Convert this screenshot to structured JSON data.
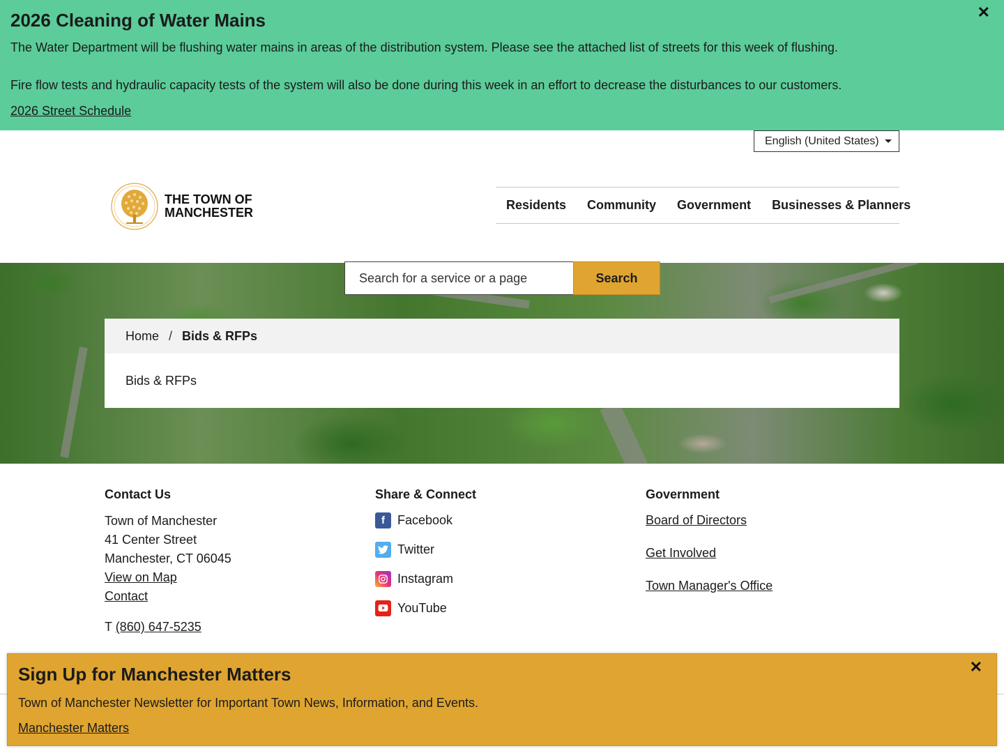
{
  "alert": {
    "title": "2026 Cleaning of Water Mains",
    "paragraph1": "The Water Department will be flushing water mains in areas of the distribution system. Please see the attached list of streets for this week of flushing.",
    "paragraph2": "Fire flow tests and hydraulic capacity tests of the system will also be done during this week in an effort to decrease the disturbances to our customers.",
    "link": "2026 Street Schedule",
    "close": "✕",
    "bg_color": "#5bcc9a"
  },
  "language": {
    "selected": "English (United States)"
  },
  "logo": {
    "line1": "THE TOWN OF",
    "line2": "MANCHESTER"
  },
  "nav": {
    "items": [
      "Residents",
      "Community",
      "Government",
      "Businesses & Planners"
    ]
  },
  "search": {
    "placeholder": "Search for a service or a page",
    "button": "Search",
    "accent": "#e0a530"
  },
  "breadcrumb": {
    "home": "Home",
    "separator": "/",
    "current": "Bids & RFPs"
  },
  "page": {
    "body": "Bids & RFPs"
  },
  "footer": {
    "contact": {
      "heading": "Contact Us",
      "name": "Town of Manchester",
      "street": "41 Center Street",
      "city": "Manchester, CT 06045",
      "map_link": "View on Map",
      "contact_link": "Contact",
      "phone_prefix": "T",
      "phone": "(860) 647-5235"
    },
    "share": {
      "heading": "Share & Connect",
      "items": [
        {
          "label": "Facebook",
          "icon": "facebook-icon",
          "color": "#3b5998"
        },
        {
          "label": "Twitter",
          "icon": "twitter-icon",
          "color": "#55acee"
        },
        {
          "label": "Instagram",
          "icon": "instagram-icon",
          "color": "#d6249f"
        },
        {
          "label": "YouTube",
          "icon": "youtube-icon",
          "color": "#e62117"
        }
      ]
    },
    "government": {
      "heading": "Government",
      "links": [
        "Board of Directors",
        "Get Involved",
        "Town Manager's Office"
      ]
    }
  },
  "popup": {
    "title": "Sign Up for Manchester Matters",
    "text": "Town of Manchester Newsletter for Important Town News, Information, and Events.",
    "link": "Manchester Matters",
    "close": "✕",
    "bg_color": "#e0a530"
  }
}
